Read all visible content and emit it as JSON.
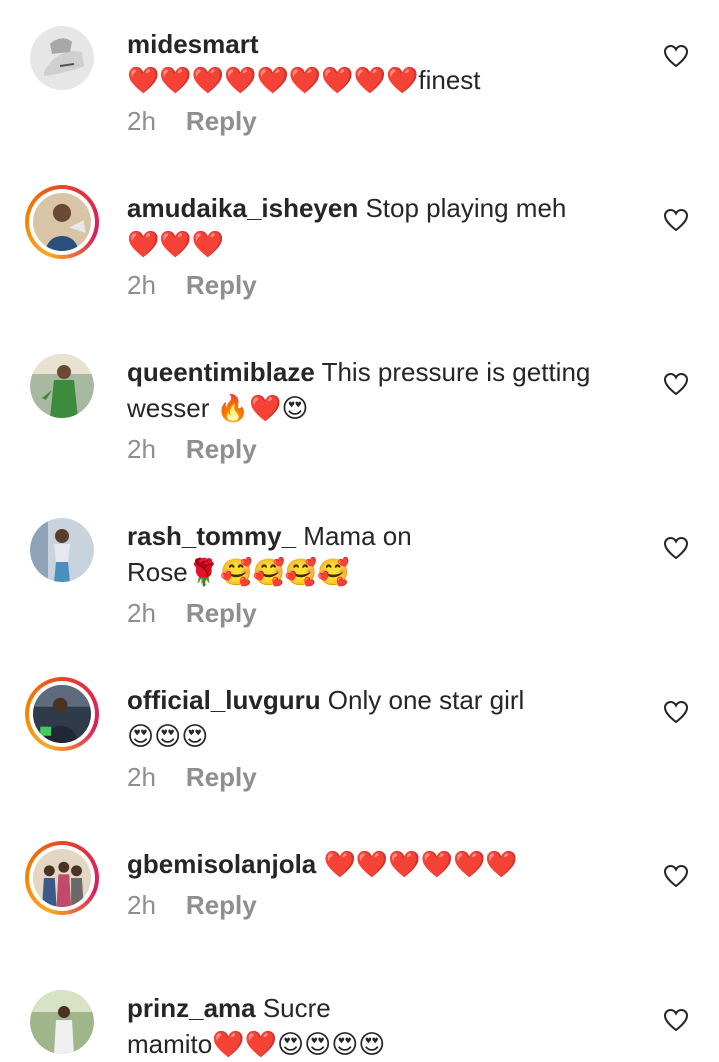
{
  "comments": [
    {
      "username": "midesmart",
      "text": "",
      "text2": "❤️❤️❤️❤️❤️❤️❤️❤️❤️finest",
      "time": "2h",
      "reply": "Reply",
      "avatar_color": "#bdbdbd",
      "story_ring": false
    },
    {
      "username": "amudaika_isheyen",
      "text": " Stop playing meh",
      "text2": "❤️❤️❤️",
      "time": "2h",
      "reply": "Reply",
      "avatar_color": "#c9b08a",
      "story_ring": true
    },
    {
      "username": "queentimiblaze",
      "text": " This pressure is getting",
      "text2": "wesser 🔥❤️😍",
      "time": "2h",
      "reply": "Reply",
      "avatar_color": "#6b8e5a",
      "story_ring": false
    },
    {
      "username": "rash_tommy_",
      "text": " Mama on",
      "text2": "Rose🌹🥰🥰🥰🥰",
      "time": "2h",
      "reply": "Reply",
      "avatar_color": "#7d8fa8",
      "story_ring": false
    },
    {
      "username": "official_luvguru",
      "text": " Only one star girl",
      "text2": "😍😍😍",
      "time": "2h",
      "reply": "Reply",
      "avatar_color": "#3c4a5c",
      "story_ring": true
    },
    {
      "username": "gbemisolanjola",
      "text": " ❤️❤️❤️❤️❤️❤️",
      "text2": "",
      "time": "2h",
      "reply": "Reply",
      "avatar_color": "#8c6b4f",
      "story_ring": true
    },
    {
      "username": "prinz_ama",
      "text": " Sucre",
      "text2": "mamito❤️❤️😍😍😍😍",
      "time": "",
      "reply": "",
      "avatar_color": "#5a7d4a",
      "story_ring": false
    }
  ],
  "icons": {
    "like": "heart-outline-icon"
  },
  "colors": {
    "text": "#262626",
    "muted": "#8e8e8e",
    "heart": "#e0245e"
  }
}
